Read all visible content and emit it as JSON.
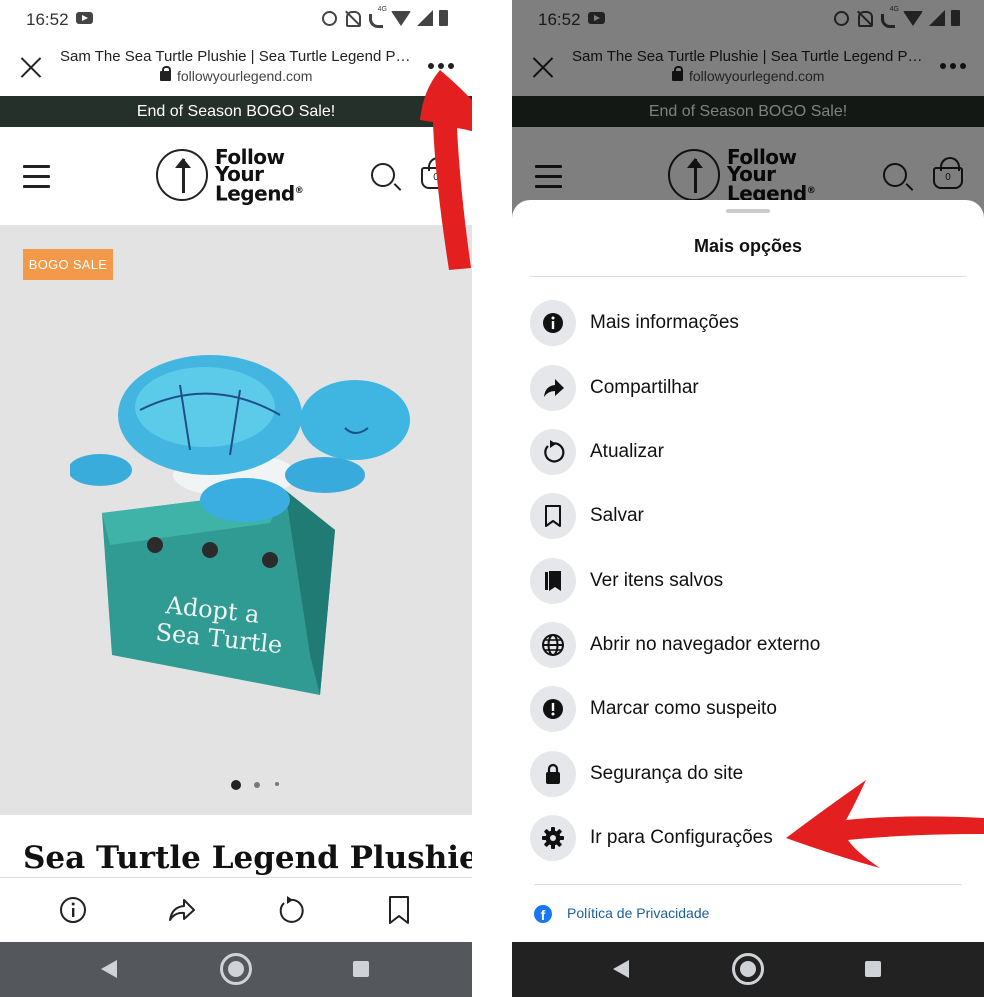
{
  "status": {
    "time": "16:52",
    "network": "4G"
  },
  "browser": {
    "title": "Sam The Sea Turtle Plushie | Sea Turtle Legend Plushie",
    "url": "followyourlegend.com"
  },
  "site": {
    "banner": "End of Season BOGO Sale!",
    "logo_lines": [
      "Follow",
      "Your",
      "Legend"
    ],
    "logo_mark": "®",
    "cart_count": "0",
    "badge": "BOGO SALE",
    "product_box_text_1": "Adopt a",
    "product_box_text_2": "Sea Turtle",
    "product_title": "Sea Turtle Legend Plushie",
    "carousel": {
      "count": 3,
      "active": 0
    }
  },
  "sheet": {
    "title": "Mais opções",
    "items": [
      {
        "label": "Mais informações",
        "icon": "info-icon"
      },
      {
        "label": "Compartilhar",
        "icon": "share-icon"
      },
      {
        "label": "Atualizar",
        "icon": "refresh-icon"
      },
      {
        "label": "Salvar",
        "icon": "bookmark-icon"
      },
      {
        "label": "Ver itens salvos",
        "icon": "saved-items-icon"
      },
      {
        "label": "Abrir no navegador externo",
        "icon": "globe-icon"
      },
      {
        "label": "Marcar como suspeito",
        "icon": "alert-icon"
      },
      {
        "label": "Segurança do site",
        "icon": "lock-icon"
      },
      {
        "label": "Ir para Configurações",
        "icon": "gear-icon"
      }
    ],
    "privacy_label": "Política de Privacidade",
    "privacy_icon": "facebook-icon"
  },
  "colors": {
    "banner_bg": "#26302a",
    "badge_bg": "#f29a4a",
    "annotation": "#e41f1f",
    "link": "#1b5e9a",
    "facebook": "#1877f2"
  }
}
